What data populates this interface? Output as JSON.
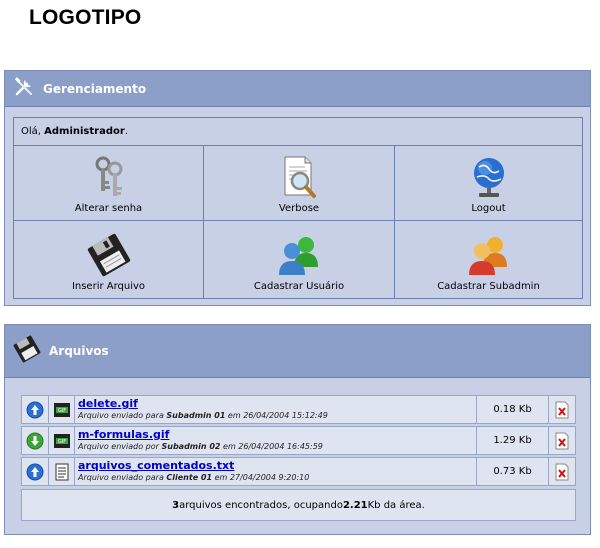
{
  "logo": {
    "text": "LOGOTIPO"
  },
  "management": {
    "title": "Gerenciamento",
    "greeting_prefix": "Olá, ",
    "user_name": "Administrador",
    "greeting_suffix": ".",
    "actions": [
      {
        "label": "Alterar senha",
        "icon": "keys-icon"
      },
      {
        "label": "Verbose",
        "icon": "document-magnifier-icon"
      },
      {
        "label": "Logout",
        "icon": "globe-icon"
      },
      {
        "label": "Inserir Arquivo",
        "icon": "floppy-disk-icon"
      },
      {
        "label": "Cadastrar Usuário",
        "icon": "users-icon"
      },
      {
        "label": "Cadastrar Subadmin",
        "icon": "subadmin-users-icon"
      }
    ]
  },
  "files": {
    "title": "Arquivos",
    "rows": [
      {
        "direction": "up",
        "type": "GIF",
        "name": "delete.gif",
        "desc_prefix": "Arquivo enviado para ",
        "who": "Subadmin 01",
        "desc_mid": " em ",
        "date": "26/04/2004 15:12:49",
        "size": "0.18 Kb"
      },
      {
        "direction": "down",
        "type": "GIF",
        "name": "m-formulas.gif",
        "desc_prefix": "Arquivo enviado por ",
        "who": "Subadmin 02",
        "desc_mid": " em ",
        "date": "26/04/2004 16:45:59",
        "size": "1.29 Kb"
      },
      {
        "direction": "up",
        "type": "TXT",
        "name": "arquivos_comentados.txt",
        "desc_prefix": "Arquivo enviado para ",
        "who": "Cliente 01",
        "desc_mid": " em ",
        "date": "27/04/2004 9:20:10",
        "size": "0.73 Kb"
      }
    ],
    "summary": {
      "count": "3",
      "text1": " arquivos encontrados, ocupando ",
      "total": "2.21",
      "text2": " Kb da área."
    }
  },
  "colors": {
    "panel_bg": "#c8d0e6",
    "header_bg": "#8c9fc8",
    "row_bg": "#dfe4f1",
    "link": "#0000cc"
  }
}
